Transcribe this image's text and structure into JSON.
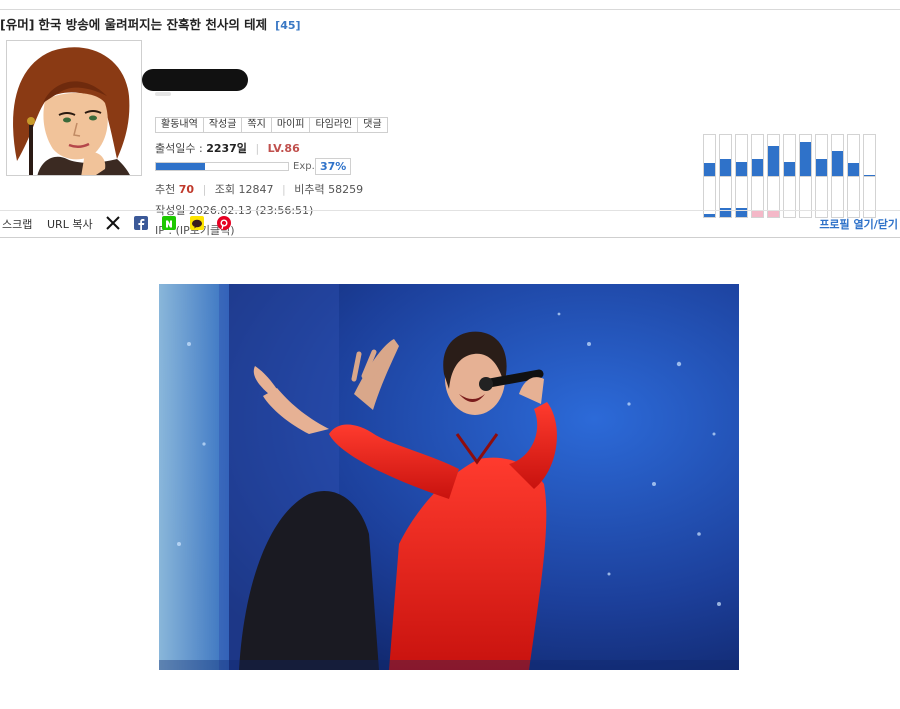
{
  "post": {
    "category": "[유머]",
    "title": "한국 방송에 울려퍼지는 잔혹한 천사의 테제",
    "comment_count": "[45]"
  },
  "profile": {
    "menu": [
      "활동내역",
      "작성글",
      "쪽지",
      "마이피",
      "타임라인",
      "댓글"
    ],
    "attendance_label": "출석일수 :",
    "attendance_value": "2237일",
    "level": "LV.86",
    "exp_label": "Exp.",
    "exp_percent": "37%",
    "exp_fraction": 0.37,
    "recommend_label": "추천",
    "recommend_value": "70",
    "views_label": "조회",
    "views_value": "12847",
    "ratio_label": "비추력",
    "ratio_value": "58259",
    "date": "작성일 2026.02.13 (23:56:51)",
    "ip": "IP : (IP보기클릭)",
    "activity_bars": [
      {
        "up": 0.32,
        "down": 0.08,
        "down_color": "#2f72c9"
      },
      {
        "up": 0.42,
        "down": 0.22,
        "down_color": "#2f72c9"
      },
      {
        "up": 0.35,
        "down": 0.22,
        "down_color": "#2f72c9"
      },
      {
        "up": 0.42,
        "down": 0.18,
        "down_color": "#f4b8c8"
      },
      {
        "up": 0.72,
        "down": 0.18,
        "down_color": "#f4b8c8"
      },
      {
        "up": 0.35,
        "down": 0.0,
        "down_color": "#2f72c9"
      },
      {
        "up": 0.82,
        "down": 0.0,
        "down_color": "#2f72c9"
      },
      {
        "up": 0.42,
        "down": 0.0,
        "down_color": "#2f72c9"
      },
      {
        "up": 0.62,
        "down": 0.0,
        "down_color": "#2f72c9"
      },
      {
        "up": 0.32,
        "down": 0.0,
        "down_color": "#2f72c9"
      },
      {
        "up": 0.03,
        "down": 0.0,
        "down_color": "#2f72c9"
      }
    ]
  },
  "share": {
    "scrap": "스크랩",
    "url_copy": "URL 복사",
    "icons": [
      "x-icon",
      "facebook-icon",
      "naver-icon",
      "kakao-icon",
      "pinterest-icon"
    ],
    "profile_toggle": "프로필 열기/닫기"
  },
  "colors": {
    "accent_blue": "#2f72c9",
    "level_red": "#c0504d",
    "pink_bar": "#f4b8c8"
  }
}
